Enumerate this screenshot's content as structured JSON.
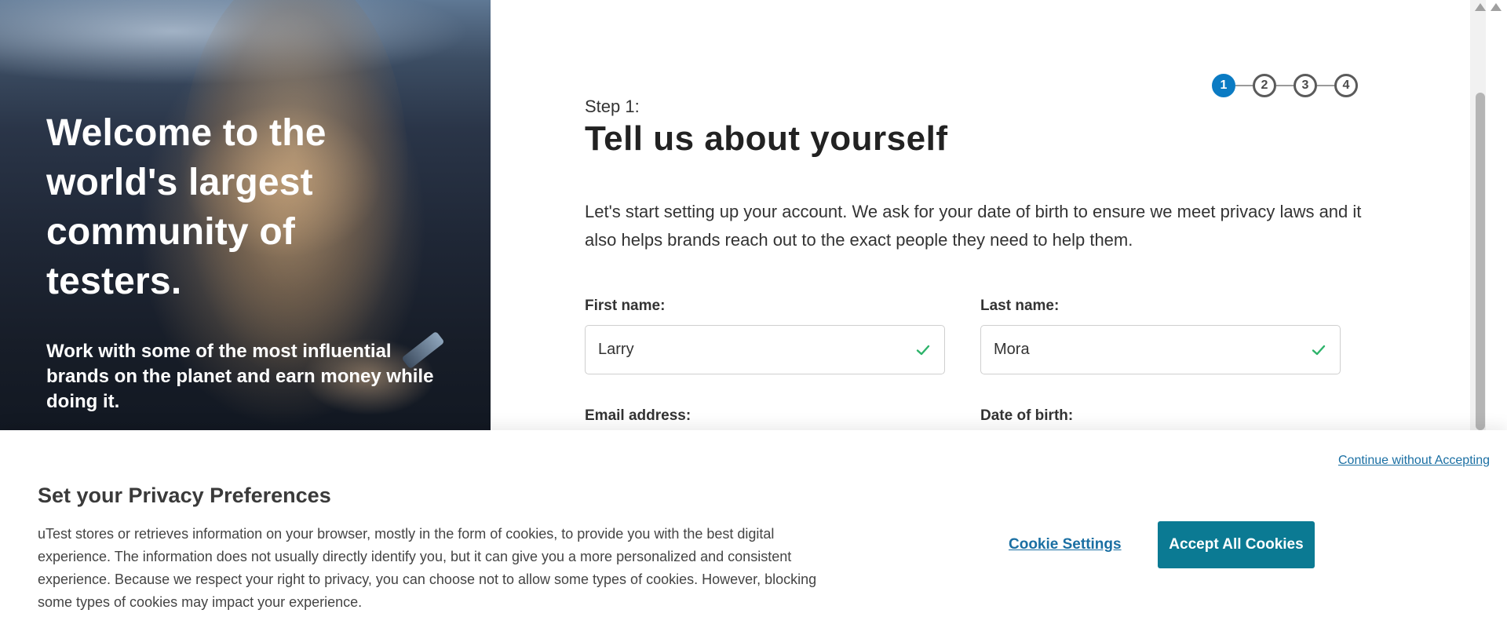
{
  "hero": {
    "title": "Welcome to the world's largest community of testers.",
    "subtitle": "Work with some of the most influential brands on the planet and earn money while doing it."
  },
  "stepper": {
    "steps": [
      "1",
      "2",
      "3",
      "4"
    ],
    "active_step": 1
  },
  "form": {
    "step_label": "Step 1:",
    "title": "Tell us about yourself",
    "intro": "Let's start setting up your account. We ask for your date of birth to ensure we meet privacy laws and it also helps brands reach out to the exact people they need to help them.",
    "first_name": {
      "label": "First name:",
      "value": "Larry",
      "valid": true
    },
    "last_name": {
      "label": "Last name:",
      "value": "Mora",
      "valid": true
    },
    "email": {
      "label": "Email address:"
    },
    "dob": {
      "label": "Date of birth:"
    }
  },
  "cookie_banner": {
    "continue_link": "Continue without Accepting",
    "title": "Set your Privacy Preferences",
    "text": "uTest stores or retrieves information on your browser, mostly in the form of cookies, to provide you with the best digital experience. The information does not usually directly identify you, but it can give you a more personalized and consistent experience. Because we respect your right to privacy, you can choose not to allow some types of cookies. However, blocking some types of cookies may impact your experience.",
    "settings_label": "Cookie Settings",
    "accept_label": "Accept All Cookies"
  },
  "colors": {
    "accent_blue": "#0b7bc3",
    "accept_button": "#0b7a93",
    "link": "#1a6fa3",
    "valid_check": "#2db36a"
  },
  "icons": {
    "valid": "check-icon",
    "scroll_up": "triangle-up-icon"
  }
}
